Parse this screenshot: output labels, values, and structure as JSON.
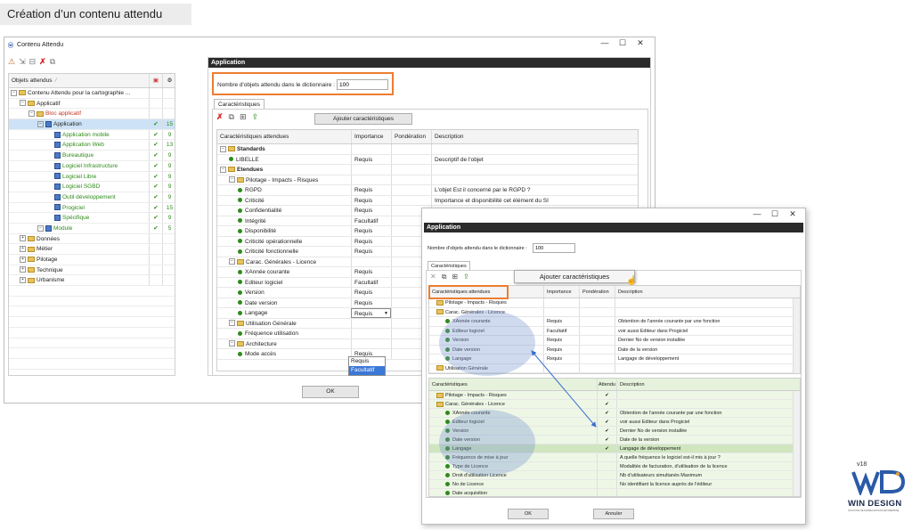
{
  "slide_title": "Création d’un contenu attendu",
  "main_window": {
    "title": "Contenu Attendu",
    "controls": [
      "—",
      "☐",
      "✕"
    ],
    "left_panel": {
      "header": "Objets attendus",
      "sort_glyph": "⁄",
      "tree": [
        {
          "label": "Contenu Attendu pour la cartographie ...",
          "level": 0,
          "type": "root",
          "check": "",
          "count": ""
        },
        {
          "label": "Applicatif",
          "level": 1,
          "type": "folder",
          "check": "",
          "count": ""
        },
        {
          "label": "Bloc applicatif",
          "level": 2,
          "type": "folder-red",
          "check": "",
          "count": ""
        },
        {
          "label": "Application",
          "level": 3,
          "type": "module",
          "check": "✔",
          "count": "15",
          "selected": true
        },
        {
          "label": "Application mobile",
          "level": 4,
          "type": "module",
          "check": "✔",
          "count": "9",
          "green": true
        },
        {
          "label": "Application Web",
          "level": 4,
          "type": "module",
          "check": "✔",
          "count": "13",
          "green": true
        },
        {
          "label": "Bureautique",
          "level": 4,
          "type": "module",
          "check": "✔",
          "count": "9",
          "green": true
        },
        {
          "label": "Logiciel Infrastructure",
          "level": 4,
          "type": "module",
          "check": "✔",
          "count": "9",
          "green": true
        },
        {
          "label": "Logiciel Libre",
          "level": 4,
          "type": "module",
          "check": "✔",
          "count": "9",
          "green": true
        },
        {
          "label": "Logiciel SGBD",
          "level": 4,
          "type": "module",
          "check": "✔",
          "count": "9",
          "green": true
        },
        {
          "label": "Outil développement",
          "level": 4,
          "type": "module",
          "check": "✔",
          "count": "9",
          "green": true
        },
        {
          "label": "Progiciel",
          "level": 4,
          "type": "module",
          "check": "✔",
          "count": "15",
          "green": true
        },
        {
          "label": "Spécifique",
          "level": 4,
          "type": "module",
          "check": "✔",
          "count": "9",
          "green": true
        },
        {
          "label": "Module",
          "level": 3,
          "type": "module",
          "check": "✔",
          "count": "5",
          "green": true
        },
        {
          "label": "Données",
          "level": 1,
          "type": "folder",
          "check": "",
          "count": ""
        },
        {
          "label": "Métier",
          "level": 1,
          "type": "folder",
          "check": "",
          "count": ""
        },
        {
          "label": "Pilotage",
          "level": 1,
          "type": "folder",
          "check": "",
          "count": ""
        },
        {
          "label": "Technique",
          "level": 1,
          "type": "folder",
          "check": "",
          "count": ""
        },
        {
          "label": "Urbanisme",
          "level": 1,
          "type": "folder",
          "check": "",
          "count": ""
        }
      ]
    },
    "right_panel": {
      "title": "Application",
      "dict_label": "Nombre d'objets attendu dans le dictionnaire :",
      "dict_value": "100",
      "tab": "Caractéristiques",
      "add_button": "Ajouter caractéristiques",
      "columns": [
        "Caractéristiques attendues",
        "Importance",
        "Pondération",
        "Description"
      ],
      "rows": [
        {
          "label": "Standards",
          "level": 0,
          "type": "folder",
          "bold": true,
          "imp": "",
          "desc": ""
        },
        {
          "label": "LIBELLE",
          "level": 1,
          "type": "dot",
          "imp": "Requis",
          "desc": "Descriptif de l'objet"
        },
        {
          "label": "Etendues",
          "level": 0,
          "type": "folder",
          "bold": true,
          "imp": "",
          "desc": ""
        },
        {
          "label": "Pilotage - Impacts - Risques",
          "level": 1,
          "type": "folder",
          "imp": "",
          "desc": ""
        },
        {
          "label": "RGPD",
          "level": 2,
          "type": "dot",
          "imp": "Requis",
          "desc": "L'objet Est il concerné par le RGPD ?"
        },
        {
          "label": "Criticité",
          "level": 2,
          "type": "dot",
          "imp": "Requis",
          "desc": "Importance et disponibilité cet élément du SI"
        },
        {
          "label": "Confidentialité",
          "level": 2,
          "type": "dot",
          "imp": "Requis",
          "desc": ""
        },
        {
          "label": "Intégrité",
          "level": 2,
          "type": "dot",
          "imp": "Facultatif",
          "desc": ""
        },
        {
          "label": "Disponibilité",
          "level": 2,
          "type": "dot",
          "imp": "Requis",
          "desc": ""
        },
        {
          "label": "Criticité opérationnelle",
          "level": 2,
          "type": "dot",
          "imp": "Requis",
          "desc": ""
        },
        {
          "label": "Criticité fonctionnelle",
          "level": 2,
          "type": "dot",
          "imp": "Requis",
          "desc": ""
        },
        {
          "label": "Carac. Générales - Licence",
          "level": 1,
          "type": "folder",
          "imp": "",
          "desc": ""
        },
        {
          "label": "XAnnée courante",
          "level": 2,
          "type": "dot",
          "imp": "Requis",
          "desc": ""
        },
        {
          "label": "Editeur logiciel",
          "level": 2,
          "type": "dot",
          "imp": "Facultatif",
          "desc": ""
        },
        {
          "label": "Version",
          "level": 2,
          "type": "dot",
          "imp": "Requis",
          "desc": ""
        },
        {
          "label": "Date version",
          "level": 2,
          "type": "dot",
          "imp": "Requis",
          "desc": ""
        },
        {
          "label": "Langage",
          "level": 2,
          "type": "dot",
          "imp": "Requis",
          "desc": "",
          "dropdown": true
        },
        {
          "label": "Utilisation Générale",
          "level": 1,
          "type": "folder",
          "imp": "",
          "desc": ""
        },
        {
          "label": "Fréquence utilisation",
          "level": 2,
          "type": "dot",
          "imp": "",
          "desc": ""
        },
        {
          "label": "Architecture",
          "level": 1,
          "type": "folder",
          "imp": "",
          "desc": ""
        },
        {
          "label": "Mode accès",
          "level": 2,
          "type": "dot",
          "imp": "Requis",
          "desc": ""
        }
      ],
      "dropdown_options": [
        "Requis",
        "Facultatif"
      ]
    },
    "ok_button": "OK"
  },
  "overlay_window": {
    "controls": [
      "—",
      "☐",
      "✕"
    ],
    "title": "Application",
    "dict_label": "Nombre d'objets attendu dans le dictionnaire :",
    "dict_value": "100",
    "tab": "Caractéristiques",
    "add_button": "Ajouter caractéristiques",
    "top_columns": [
      "Caractéristiques attendues",
      "Importance",
      "Pondération",
      "Description"
    ],
    "top_rows": [
      {
        "label": "Pilotage - Impacts - Risques",
        "type": "folder",
        "level": 0,
        "imp": "",
        "desc": ""
      },
      {
        "label": "Carac. Générales - Licence",
        "type": "folder",
        "level": 0,
        "imp": "",
        "desc": ""
      },
      {
        "label": "XAnnée courante",
        "type": "dot",
        "level": 1,
        "imp": "Requis",
        "desc": "Obtention de l'année courante par une fonction"
      },
      {
        "label": "Editeur logiciel",
        "type": "dot",
        "level": 1,
        "imp": "Facultatif",
        "desc": "voir aussi Editeur dans Progiciel"
      },
      {
        "label": "Version",
        "type": "dot",
        "level": 1,
        "imp": "Requis",
        "desc": "Dernier No de version installée"
      },
      {
        "label": "Date version",
        "type": "dot",
        "level": 1,
        "imp": "Requis",
        "desc": "Date de la version"
      },
      {
        "label": "Langage",
        "type": "dot",
        "level": 1,
        "imp": "Requis",
        "desc": "Langage de développement"
      },
      {
        "label": "Utilisation Générale",
        "type": "folder",
        "level": 0,
        "imp": "",
        "desc": ""
      }
    ],
    "bottom_columns": [
      "Caractéristiques",
      "Attendu",
      "Description"
    ],
    "bottom_rows": [
      {
        "label": "Pilotage - Impacts - Risques",
        "type": "folder",
        "level": 0,
        "check": "✔",
        "desc": ""
      },
      {
        "label": "Carac. Générales - Licence",
        "type": "folder",
        "level": 0,
        "check": "✔",
        "desc": ""
      },
      {
        "label": "XAnnée courante",
        "type": "dot",
        "level": 1,
        "check": "✔",
        "desc": "Obtention de l'année courante par une fonction"
      },
      {
        "label": "Editeur logiciel",
        "type": "dot",
        "level": 1,
        "check": "✔",
        "desc": "voir aussi Editeur dans Progiciel"
      },
      {
        "label": "Version",
        "type": "dot",
        "level": 1,
        "check": "✔",
        "desc": "Dernier No de version installée"
      },
      {
        "label": "Date version",
        "type": "dot",
        "level": 1,
        "check": "✔",
        "desc": "Date de la version"
      },
      {
        "label": "Langage",
        "type": "dot",
        "level": 1,
        "check": "✔",
        "desc": "Langage de développement",
        "highlight": true
      },
      {
        "label": "Fréquence de mise à jour",
        "type": "dot",
        "level": 1,
        "check": "",
        "desc": "A quelle fréquence le logiciel est-il mis à jour ?"
      },
      {
        "label": "Type de Licence",
        "type": "dot",
        "level": 1,
        "check": "",
        "desc": "Modalités de facturation, d'utilisation de la licence"
      },
      {
        "label": "Droit d'utilisation Licence",
        "type": "dot",
        "level": 1,
        "check": "",
        "desc": "Nb d'utilisateurs simultanés Maximum"
      },
      {
        "label": "No de Licence",
        "type": "dot",
        "level": 1,
        "check": "",
        "desc": "No identifiant la licence auprès de l'éditeur"
      },
      {
        "label": "Date acquisition",
        "type": "dot",
        "level": 1,
        "check": "",
        "desc": ""
      }
    ],
    "ok_button": "OK",
    "cancel_button": "Annuler"
  },
  "logo": {
    "text": "WIN DESIGN",
    "version": "v18",
    "tagline": "SOLUTION DE MODÉLISATION D'ENTREPRISE",
    "accent": "#2a5aa8"
  },
  "colors": {
    "orange": "#ed7d31",
    "check_green": "#2e8b1a",
    "tree_green": "#2e8b1a",
    "titlebar_dark": "#2b2b2b"
  }
}
